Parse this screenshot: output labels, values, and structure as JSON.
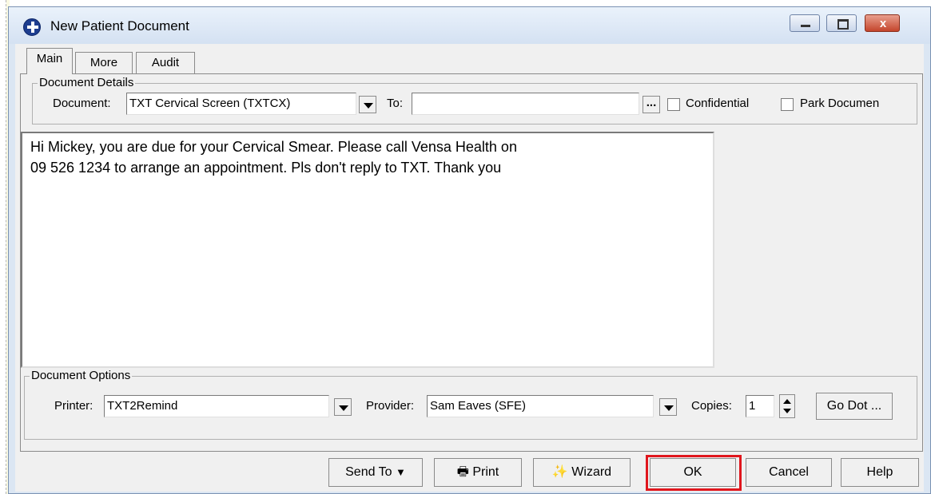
{
  "window": {
    "title": "New Patient Document",
    "close_glyph": "x"
  },
  "tabs": [
    {
      "label": "Main"
    },
    {
      "label": "More"
    },
    {
      "label": "Audit"
    }
  ],
  "document_details": {
    "group_title": "Document Details",
    "document_label": "Document:",
    "document_value": "TXT Cervical Screen (TXTCX)",
    "to_label": "To:",
    "to_value": "",
    "to_button": "...",
    "confidential_label": "Confidential",
    "park_label": "Park Documen"
  },
  "message": {
    "line1": "Hi Mickey, you are due for your Cervical Smear. Please call Vensa Health on",
    "line2": "09 526 1234 to arrange an appointment. Pls don't reply to TXT. Thank you"
  },
  "document_options": {
    "group_title": "Document Options",
    "printer_label": "Printer:",
    "printer_value": "TXT2Remind",
    "provider_label": "Provider:",
    "provider_value": "Sam Eaves (SFE)",
    "copies_label": "Copies:",
    "copies_value": "1",
    "godot_button": "Go Dot ..."
  },
  "buttons": {
    "send_to": "Send To",
    "print": "Print",
    "wizard": "Wizard",
    "ok": "OK",
    "cancel": "Cancel",
    "help": "Help"
  },
  "colors": {
    "highlight": "#e0161d",
    "titlebar": "#dbe6f3"
  }
}
